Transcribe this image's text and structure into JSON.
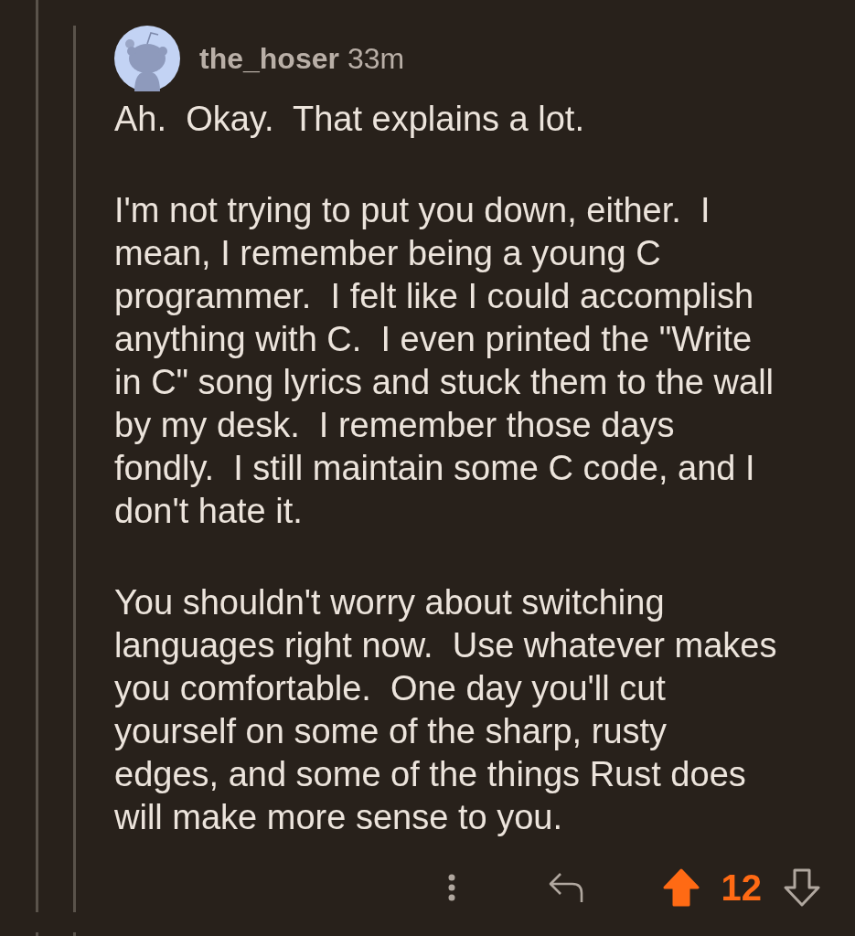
{
  "comment": {
    "author": "the_hoser",
    "time": "33m",
    "paragraphs": [
      "Ah.  Okay.  That explains a lot.",
      "I'm not trying to put you down, either.  I mean, I remember being a young C programmer.  I felt like I could accomplish anything with C.  I even printed the \"Write in C\" song lyrics and stuck them to the wall by my desk.  I remember those days fondly.  I still maintain some C code, and I don't hate it.",
      "You shouldn't worry about switching languages right now.  Use whatever makes you comfortable.  One day you'll cut yourself on some of the sharp, rusty edges, and some of the things Rust does will make more sense to you."
    ],
    "score": "12",
    "upvoted": true,
    "downvoted": false
  }
}
